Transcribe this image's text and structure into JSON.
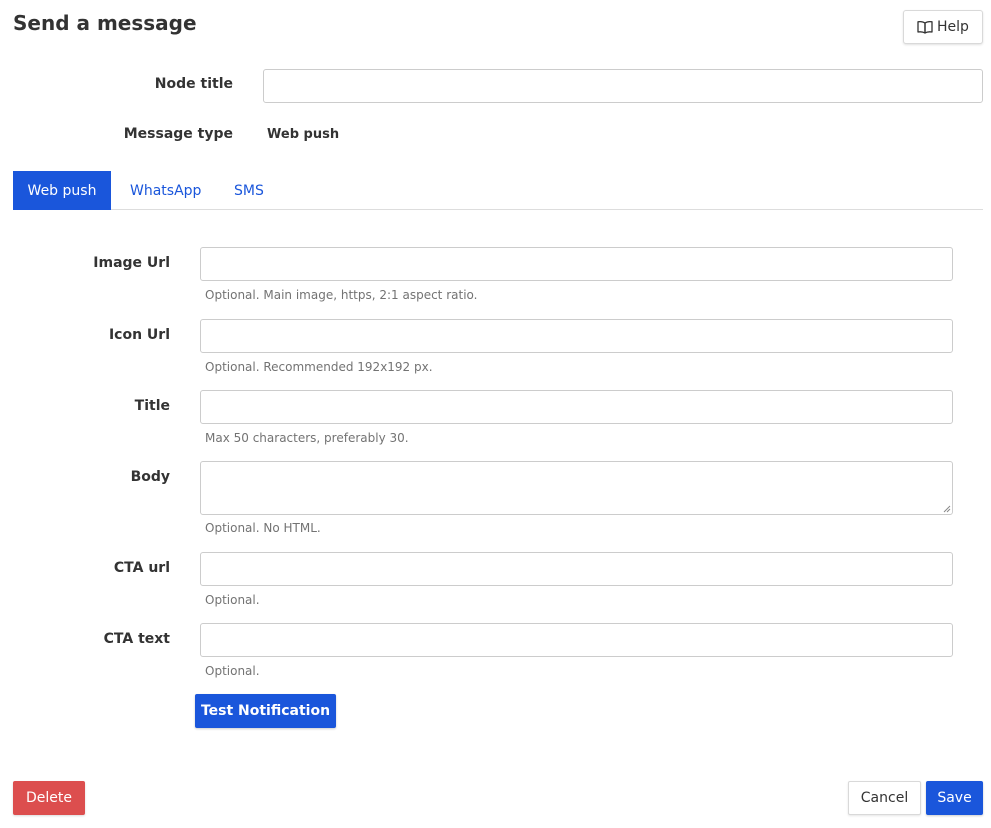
{
  "header": {
    "title": "Send a message",
    "help_label": "Help",
    "help_icon": "book-open-icon"
  },
  "node": {
    "title_label": "Node title",
    "title_value": "",
    "message_type_label": "Message type",
    "message_type_value": "Web push"
  },
  "tabs": [
    {
      "label": "Web push",
      "active": true
    },
    {
      "label": "WhatsApp",
      "active": false
    },
    {
      "label": "SMS",
      "active": false
    }
  ],
  "fields": {
    "image_url": {
      "label": "Image Url",
      "value": "",
      "help": "Optional. Main image, https, 2:1 aspect ratio."
    },
    "icon_url": {
      "label": "Icon Url",
      "value": "",
      "help": "Optional. Recommended 192x192 px."
    },
    "title": {
      "label": "Title",
      "value": "",
      "help": "Max 50 characters, preferably 30."
    },
    "body": {
      "label": "Body",
      "value": "",
      "help": "Optional. No HTML."
    },
    "cta_url": {
      "label": "CTA url",
      "value": "",
      "help": "Optional."
    },
    "cta_text": {
      "label": "CTA text",
      "value": "",
      "help": "Optional."
    }
  },
  "actions": {
    "test_label": "Test Notification",
    "delete_label": "Delete",
    "cancel_label": "Cancel",
    "save_label": "Save"
  },
  "colors": {
    "primary": "#1a56db",
    "danger": "#dc4e4e",
    "help_text": "#737373"
  }
}
